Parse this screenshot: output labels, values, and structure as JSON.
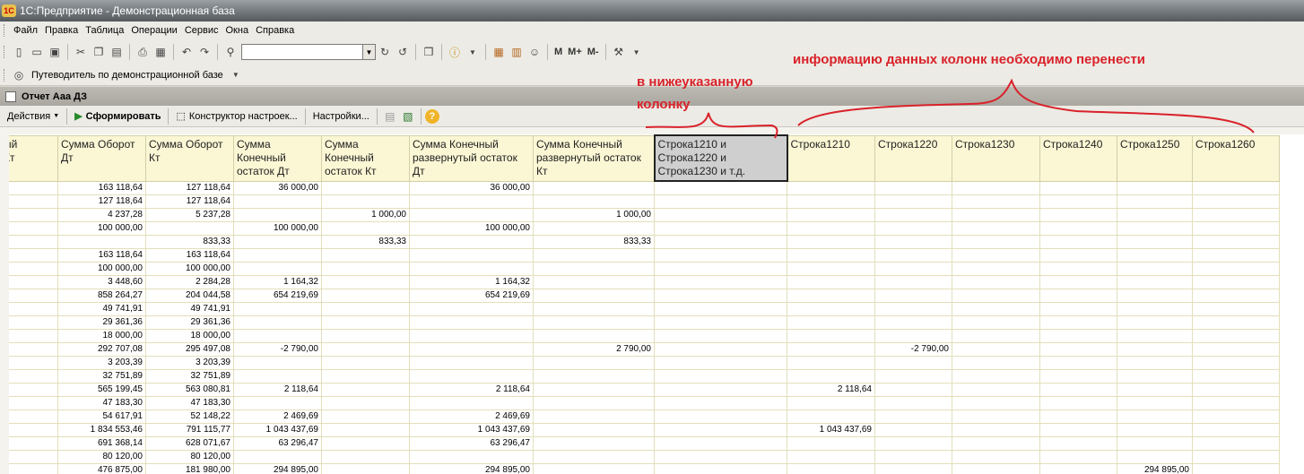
{
  "window": {
    "title": "1С:Предприятие - Демонстрационная база",
    "logo": "1С"
  },
  "menu": [
    "Файл",
    "Правка",
    "Таблица",
    "Операции",
    "Сервис",
    "Окна",
    "Справка"
  ],
  "toolbar": {
    "m_labels": [
      "M",
      "M+",
      "M-"
    ],
    "search_value": ""
  },
  "guide": {
    "label": "Путеводитель по демонстрационной базе"
  },
  "document": {
    "title": "Отчет  Ааа ДЗ"
  },
  "doc_toolbar": {
    "actions": "Действия",
    "form": "Сформировать",
    "constructor": "Конструктор настроек...",
    "settings": "Настройки..."
  },
  "annotations": {
    "top": "информацию данных колонк необходимо перенести",
    "left_line1": "в нижеуказанную",
    "left_line2": "колонку"
  },
  "table": {
    "headers": [
      "ый\nКт",
      "Сумма Оборот\nДт",
      "Сумма Оборот\nКт",
      "Сумма\nКонечный\nостаток Дт",
      "Сумма\nКонечный\nостаток Кт",
      "Сумма Конечный\nразвернутый остаток\nДт",
      "Сумма Конечный\nразвернутый остаток\nКт",
      "Строка1210 и\nСтрока1220 и\nСтрока1230 и т.д.",
      "Строка1210",
      "Строка1220",
      "Строка1230",
      "Строка1240",
      "Строка1250",
      "Строка1260"
    ],
    "rows": [
      [
        "",
        "163 118,64",
        "127 118,64",
        "36 000,00",
        "",
        "36 000,00",
        "",
        "",
        "",
        "",
        "",
        "",
        "",
        ""
      ],
      [
        "",
        "127 118,64",
        "127 118,64",
        "",
        "",
        "",
        "",
        "",
        "",
        "",
        "",
        "",
        "",
        ""
      ],
      [
        "",
        "4 237,28",
        "5 237,28",
        "",
        "1 000,00",
        "",
        "1 000,00",
        "",
        "",
        "",
        "",
        "",
        "",
        ""
      ],
      [
        "",
        "100 000,00",
        "",
        "100 000,00",
        "",
        "100 000,00",
        "",
        "",
        "",
        "",
        "",
        "",
        "",
        ""
      ],
      [
        "",
        "",
        "833,33",
        "",
        "833,33",
        "",
        "833,33",
        "",
        "",
        "",
        "",
        "",
        "",
        ""
      ],
      [
        "",
        "163 118,64",
        "163 118,64",
        "",
        "",
        "",
        "",
        "",
        "",
        "",
        "",
        "",
        "",
        ""
      ],
      [
        "",
        "100 000,00",
        "100 000,00",
        "",
        "",
        "",
        "",
        "",
        "",
        "",
        "",
        "",
        "",
        ""
      ],
      [
        "",
        "3 448,60",
        "2 284,28",
        "1 164,32",
        "",
        "1 164,32",
        "",
        "",
        "",
        "",
        "",
        "",
        "",
        ""
      ],
      [
        "",
        "858 264,27",
        "204 044,58",
        "654 219,69",
        "",
        "654 219,69",
        "",
        "",
        "",
        "",
        "",
        "",
        "",
        ""
      ],
      [
        "",
        "49 741,91",
        "49 741,91",
        "",
        "",
        "",
        "",
        "",
        "",
        "",
        "",
        "",
        "",
        ""
      ],
      [
        "",
        "29 361,36",
        "29 361,36",
        "",
        "",
        "",
        "",
        "",
        "",
        "",
        "",
        "",
        "",
        ""
      ],
      [
        "",
        "18 000,00",
        "18 000,00",
        "",
        "",
        "",
        "",
        "",
        "",
        "",
        "",
        "",
        "",
        ""
      ],
      [
        "",
        "292 707,08",
        "295 497,08",
        "-2 790,00",
        "",
        "",
        "2 790,00",
        "",
        "",
        "-2 790,00",
        "",
        "",
        "",
        ""
      ],
      [
        "",
        "3 203,39",
        "3 203,39",
        "",
        "",
        "",
        "",
        "",
        "",
        "",
        "",
        "",
        "",
        ""
      ],
      [
        "",
        "32 751,89",
        "32 751,89",
        "",
        "",
        "",
        "",
        "",
        "",
        "",
        "",
        "",
        "",
        ""
      ],
      [
        "",
        "565 199,45",
        "563 080,81",
        "2 118,64",
        "",
        "2 118,64",
        "",
        "",
        "2 118,64",
        "",
        "",
        "",
        "",
        ""
      ],
      [
        "",
        "47 183,30",
        "47 183,30",
        "",
        "",
        "",
        "",
        "",
        "",
        "",
        "",
        "",
        "",
        ""
      ],
      [
        "",
        "54 617,91",
        "52 148,22",
        "2 469,69",
        "",
        "2 469,69",
        "",
        "",
        "",
        "",
        "",
        "",
        "",
        ""
      ],
      [
        "",
        "1 834 553,46",
        "791 115,77",
        "1 043 437,69",
        "",
        "1 043 437,69",
        "",
        "",
        "1 043 437,69",
        "",
        "",
        "",
        "",
        ""
      ],
      [
        "",
        "691 368,14",
        "628 071,67",
        "63 296,47",
        "",
        "63 296,47",
        "",
        "",
        "",
        "",
        "",
        "",
        "",
        ""
      ],
      [
        "",
        "80 120,00",
        "80 120,00",
        "",
        "",
        "",
        "",
        "",
        "",
        "",
        "",
        "",
        "",
        ""
      ],
      [
        "",
        "476 875,00",
        "181 980,00",
        "294 895,00",
        "",
        "294 895,00",
        "",
        "",
        "",
        "",
        "",
        "",
        "294 895,00",
        ""
      ]
    ]
  }
}
